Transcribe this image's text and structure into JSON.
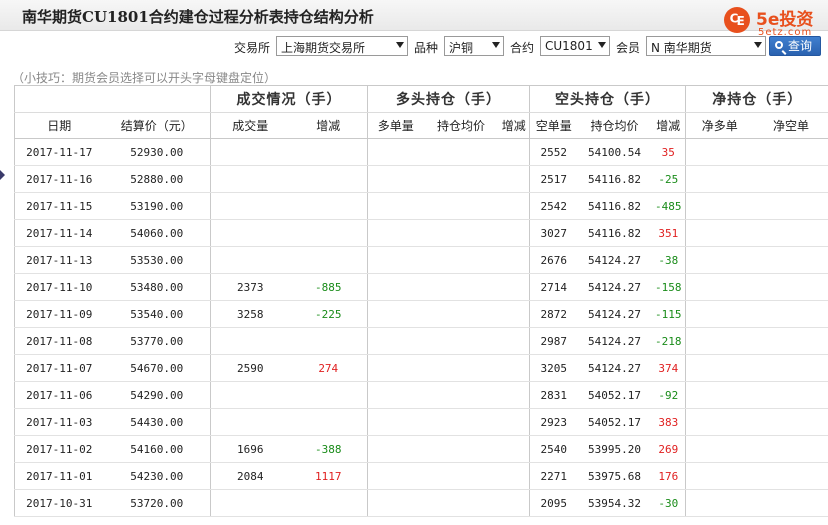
{
  "title": "南华期货CU1801合约建仓过程分析表持仓结构分析",
  "logo": {
    "mark": "₠",
    "text": "5e投资",
    "sub": "5etz.com"
  },
  "filters": {
    "exchange_label": "交易所",
    "exchange_value": "上海期货交易所",
    "variety_label": "品种",
    "variety_value": "沪铜",
    "contract_label": "合约",
    "contract_value": "CU1801",
    "member_label": "会员",
    "member_value": "N 南华期货",
    "query_label": "查询"
  },
  "tip": "（小技巧：期货会员选择可以开头字母键盘定位）",
  "table": {
    "group_headers": {
      "trade": "成交情况（手）",
      "long": "多头持仓（手）",
      "short": "空头持仓（手）",
      "net": "净持仓（手）"
    },
    "sub_headers": {
      "date": "日期",
      "settle": "结算价（元）",
      "volume": "成交量",
      "volume_change": "增减",
      "long_qty": "多单量",
      "long_avg": "持仓均价",
      "long_change": "增减",
      "short_qty": "空单量",
      "short_avg": "持仓均价",
      "short_change": "增减",
      "net_long": "净多单",
      "net_short": "净空单"
    },
    "rows": [
      {
        "date": "2017-11-17",
        "settle": "52930.00",
        "volume": "",
        "volume_change": "",
        "short_qty": "2552",
        "short_avg": "54100.54",
        "short_change": "35"
      },
      {
        "date": "2017-11-16",
        "settle": "52880.00",
        "volume": "",
        "volume_change": "",
        "short_qty": "2517",
        "short_avg": "54116.82",
        "short_change": "-25"
      },
      {
        "date": "2017-11-15",
        "settle": "53190.00",
        "volume": "",
        "volume_change": "",
        "short_qty": "2542",
        "short_avg": "54116.82",
        "short_change": "-485"
      },
      {
        "date": "2017-11-14",
        "settle": "54060.00",
        "volume": "",
        "volume_change": "",
        "short_qty": "3027",
        "short_avg": "54116.82",
        "short_change": "351"
      },
      {
        "date": "2017-11-13",
        "settle": "53530.00",
        "volume": "",
        "volume_change": "",
        "short_qty": "2676",
        "short_avg": "54124.27",
        "short_change": "-38"
      },
      {
        "date": "2017-11-10",
        "settle": "53480.00",
        "volume": "2373",
        "volume_change": "-885",
        "short_qty": "2714",
        "short_avg": "54124.27",
        "short_change": "-158"
      },
      {
        "date": "2017-11-09",
        "settle": "53540.00",
        "volume": "3258",
        "volume_change": "-225",
        "short_qty": "2872",
        "short_avg": "54124.27",
        "short_change": "-115"
      },
      {
        "date": "2017-11-08",
        "settle": "53770.00",
        "volume": "",
        "volume_change": "",
        "short_qty": "2987",
        "short_avg": "54124.27",
        "short_change": "-218"
      },
      {
        "date": "2017-11-07",
        "settle": "54670.00",
        "volume": "2590",
        "volume_change": "274",
        "short_qty": "3205",
        "short_avg": "54124.27",
        "short_change": "374"
      },
      {
        "date": "2017-11-06",
        "settle": "54290.00",
        "volume": "",
        "volume_change": "",
        "short_qty": "2831",
        "short_avg": "54052.17",
        "short_change": "-92"
      },
      {
        "date": "2017-11-03",
        "settle": "54430.00",
        "volume": "",
        "volume_change": "",
        "short_qty": "2923",
        "short_avg": "54052.17",
        "short_change": "383"
      },
      {
        "date": "2017-11-02",
        "settle": "54160.00",
        "volume": "1696",
        "volume_change": "-388",
        "short_qty": "2540",
        "short_avg": "53995.20",
        "short_change": "269"
      },
      {
        "date": "2017-11-01",
        "settle": "54230.00",
        "volume": "2084",
        "volume_change": "1117",
        "short_qty": "2271",
        "short_avg": "53975.68",
        "short_change": "176"
      },
      {
        "date": "2017-10-31",
        "settle": "53720.00",
        "volume": "",
        "volume_change": "",
        "short_qty": "2095",
        "short_avg": "53954.32",
        "short_change": "-30"
      }
    ]
  },
  "colors": {
    "positive": "#e02020",
    "negative": "#1a8c1a",
    "accent": "#e8501d",
    "button": "#2a62b0"
  }
}
